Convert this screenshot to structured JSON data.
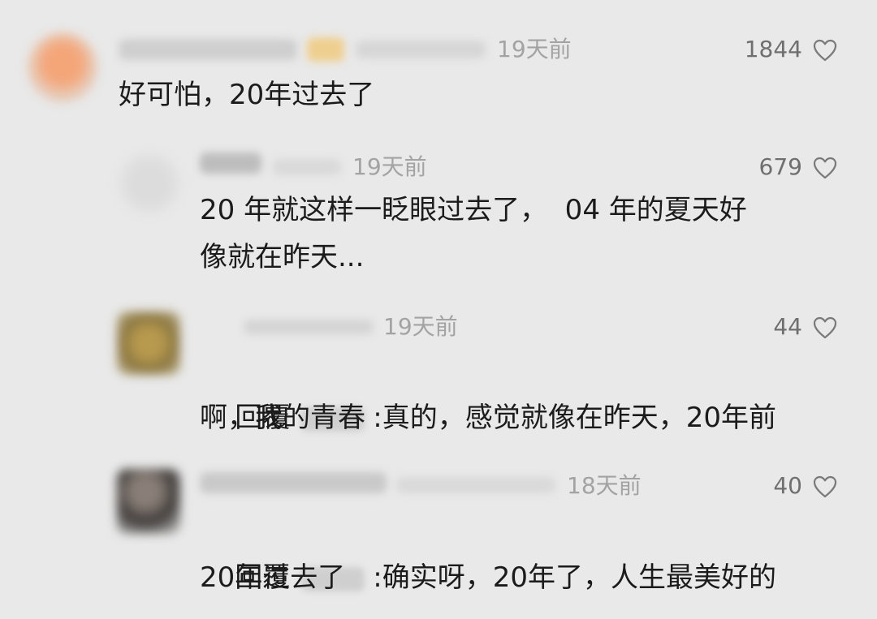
{
  "comments": [
    {
      "time": "19天前",
      "likes": "1844",
      "text": "好可怕，20年过去了"
    },
    {
      "time": "19天前",
      "likes": "679",
      "line1": "20 年就这样一眨眼过去了，  04 年的夏天好",
      "line2": "像就在昨天..."
    },
    {
      "time": "19天前",
      "likes": "44",
      "reply_prefix": "回覆",
      "line1_rest": ":真的，感觉就像在昨天，20年前",
      "line2": "啊，我的青春"
    },
    {
      "time": "18天前",
      "likes": "40",
      "reply_prefix": "回覆",
      "line1_rest": ":确实呀，20年了，人生最美好的",
      "line2": "20年过去了"
    }
  ],
  "icons": {
    "like": "heart-outline-icon"
  },
  "colors": {
    "background": "#e9e9e9",
    "text": "#1b1b1b",
    "meta": "#a3a3a3",
    "likes": "#6f6f6f"
  }
}
